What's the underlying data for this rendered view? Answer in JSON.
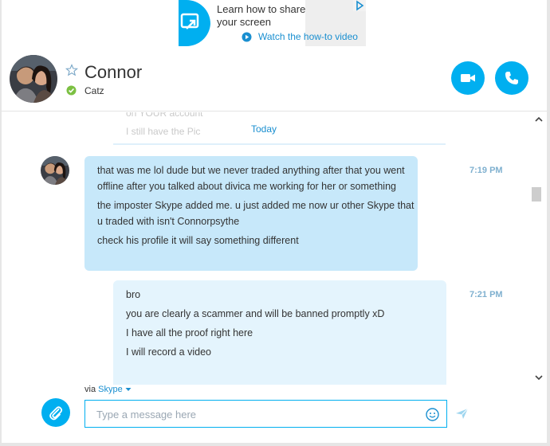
{
  "ad": {
    "title": "Learn how to share your screen",
    "link": "Watch the how-to video"
  },
  "header": {
    "contact_name": "Connor",
    "mood": "Catz",
    "status": "online"
  },
  "conversation": {
    "faded_lines": [
      "on YOUR account",
      "I still have the Pic"
    ],
    "date_divider": "Today",
    "messages": [
      {
        "direction": "incoming",
        "time": "7:19 PM",
        "lines": [
          "that was me lol dude but we never traded anything after that you went offline after you talked about divica me working for her or something",
          "the imposter Skype added me. u just added me now ur other Skype that u traded with isn't Connorpsythe",
          "check his profile it will say something different"
        ]
      },
      {
        "direction": "outgoing",
        "time": "7:21 PM",
        "lines": [
          "bro",
          "you are clearly a scammer and will be banned promptly xD",
          "I have all the proof right here",
          "I will record a video"
        ]
      }
    ]
  },
  "composer": {
    "via_prefix": "via",
    "via_service": "Skype",
    "placeholder": "Type a message here"
  },
  "colors": {
    "accent": "#00aff0",
    "incoming_bubble": "#c7e8fa",
    "outgoing_bubble": "#e4f4fd",
    "status_online": "#7cc043"
  }
}
